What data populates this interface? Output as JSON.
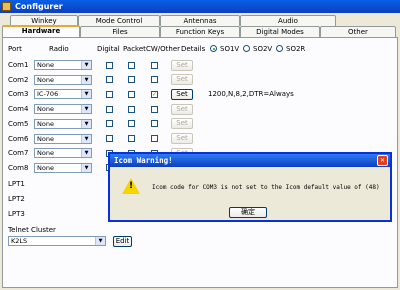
{
  "window": {
    "title": "Configurer"
  },
  "tabs_row1": [
    "Winkey",
    "Mode Control",
    "Antennas",
    "Audio"
  ],
  "tabs_row2": [
    "Hardware",
    "Files",
    "Function Keys",
    "Digital Modes",
    "Other"
  ],
  "headers": {
    "port": "Port",
    "radio": "Radio",
    "digital": "Digital",
    "packet": "Packet",
    "cw_other": "CW/Other",
    "details": "Details"
  },
  "so_options": [
    {
      "label": "SO1V",
      "selected": true
    },
    {
      "label": "SO2V",
      "selected": false
    },
    {
      "label": "SO2R",
      "selected": false
    }
  ],
  "com_ports": [
    {
      "port": "Com1",
      "radio": "None",
      "digital": false,
      "packet": false,
      "cw": false,
      "set_enabled": false,
      "details": ""
    },
    {
      "port": "Com2",
      "radio": "None",
      "digital": false,
      "packet": false,
      "cw": false,
      "set_enabled": false,
      "details": ""
    },
    {
      "port": "Com3",
      "radio": "IC-706",
      "digital": false,
      "packet": false,
      "cw": true,
      "set_enabled": true,
      "details": "1200,N,8,2,DTR=Always"
    },
    {
      "port": "Com4",
      "radio": "None",
      "digital": false,
      "packet": false,
      "cw": false,
      "set_enabled": false,
      "details": ""
    },
    {
      "port": "Com5",
      "radio": "None",
      "digital": false,
      "packet": false,
      "cw": false,
      "set_enabled": false,
      "details": ""
    },
    {
      "port": "Com6",
      "radio": "None",
      "digital": false,
      "packet": false,
      "cw": false,
      "set_enabled": false,
      "details": ""
    },
    {
      "port": "Com7",
      "radio": "None",
      "digital": false,
      "packet": false,
      "cw": false,
      "set_enabled": false,
      "details": ""
    },
    {
      "port": "Com8",
      "radio": "None",
      "digital": false,
      "packet": false,
      "cw": false,
      "set_enabled": false,
      "details": ""
    }
  ],
  "lpt_ports": [
    "LPT1",
    "LPT2",
    "LPT3"
  ],
  "set_label": "Set",
  "telnet": {
    "label": "Telnet Cluster",
    "value": "K2LS",
    "edit_label": "Edit"
  },
  "dialog": {
    "title": "Icom Warning!",
    "message": "Icom code for COM3 is not set to the Icom default value of (48)",
    "ok_label": "确定",
    "close_glyph": "✕",
    "icon_glyph": "!"
  },
  "colors": {
    "title_bar": "#0a3fbf",
    "window_bg": "#ece9d8",
    "tab_highlight": "#e8a838",
    "warning_icon": "#f5d400",
    "close_button": "#e04020"
  },
  "icons": {
    "title": "app-icon",
    "warning": "warning-icon",
    "close": "close-icon",
    "dropdown": "chevron-down-icon"
  }
}
